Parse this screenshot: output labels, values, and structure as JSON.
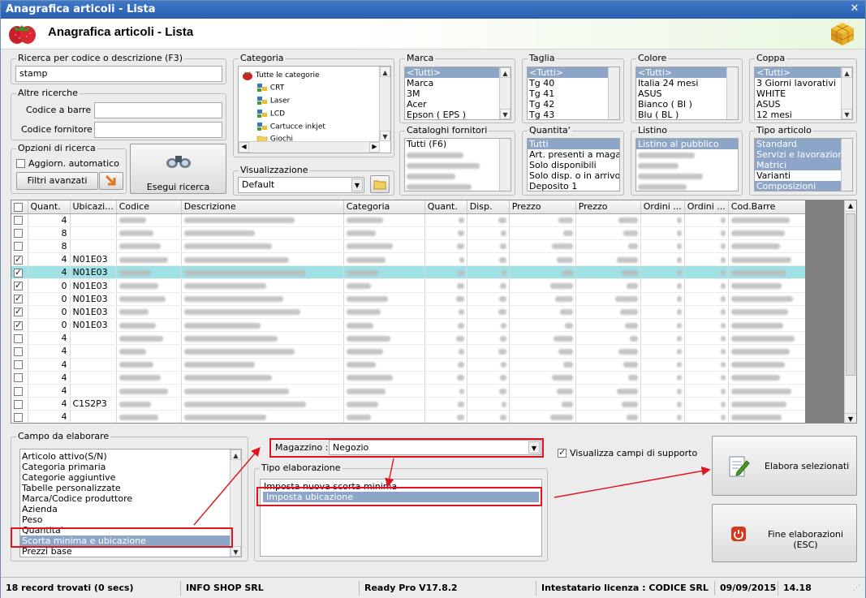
{
  "window": {
    "title": "Anagrafica articoli  - Lista",
    "close": "✕"
  },
  "header": {
    "title": "Anagrafica articoli  - Lista"
  },
  "search": {
    "legend": "Ricerca per codice o descrizione (F3)",
    "value": "stamp"
  },
  "altre": {
    "legend": "Altre ricerche",
    "barcode_label": "Codice a barre :",
    "supplier_label": "Codice fornitore :",
    "barcode_value": "",
    "supplier_value": ""
  },
  "opzioni": {
    "legend": "Opzioni di ricerca",
    "auto_update": "Aggiorn. automatico",
    "filters_button": "Filtri avanzati"
  },
  "esegui": {
    "label": "Esegui ricerca"
  },
  "categoria": {
    "legend": "Categoria",
    "root": "Tutte le categorie",
    "items": [
      "CRT",
      "Laser",
      "LCD",
      "Cartucce inkjet",
      "Giochi"
    ]
  },
  "visualizzazione": {
    "legend": "Visualizzazione",
    "value": "Default"
  },
  "marca": {
    "legend": "Marca",
    "items": [
      "<Tutti>",
      "Marca",
      "3M",
      "Acer",
      "Epson ( EPS )"
    ]
  },
  "taglia": {
    "legend": "Taglia",
    "items": [
      "<Tutti>",
      "Tg 40",
      "Tg 41",
      "Tg 42",
      "Tg 43"
    ]
  },
  "colore": {
    "legend": "Colore",
    "items": [
      "<Tutti>",
      "Italia 24 mesi",
      "ASUS",
      "Bianco ( BI )",
      "Blu ( BL )"
    ]
  },
  "coppa": {
    "legend": "Coppa",
    "items": [
      "<Tutti>",
      "3 Giorni lavorativi",
      "WHITE",
      "ASUS",
      "12 mesi"
    ]
  },
  "cataloghi": {
    "legend": "Cataloghi fornitori",
    "items": [
      "Tutti (F6)"
    ]
  },
  "quantita": {
    "legend": "Quantita'",
    "items": [
      "Tutti",
      "Art. presenti a magazzino",
      "Solo disponibili",
      "Solo disp. o in arrivo",
      "Deposito 1"
    ]
  },
  "listino": {
    "legend": "Listino",
    "items": [
      "Listino al pubblico"
    ]
  },
  "tipo_articolo": {
    "legend": "Tipo articolo",
    "items": [
      "Standard",
      "Servizi e lavorazioni",
      "Matrici",
      "Varianti",
      "Composizioni"
    ]
  },
  "grid": {
    "columns": [
      "",
      "Quant.",
      "Ubicazi...",
      "Codice",
      "Descrizione",
      "Categoria",
      "Quant.",
      "Disp.",
      "Prezzo",
      "Prezzo",
      "Ordini ...",
      "Ordini ...",
      "Cod.Barre"
    ],
    "rows": [
      {
        "checked": false,
        "quant": "4",
        "ubic": "",
        "hl": false
      },
      {
        "checked": false,
        "quant": "8",
        "ubic": "",
        "hl": false
      },
      {
        "checked": false,
        "quant": "8",
        "ubic": "",
        "hl": false
      },
      {
        "checked": true,
        "quant": "4",
        "ubic": "N01E03",
        "hl": false
      },
      {
        "checked": true,
        "quant": "4",
        "ubic": "N01E03",
        "hl": true
      },
      {
        "checked": true,
        "quant": "0",
        "ubic": "N01E03",
        "hl": false
      },
      {
        "checked": true,
        "quant": "0",
        "ubic": "N01E03",
        "hl": false
      },
      {
        "checked": true,
        "quant": "0",
        "ubic": "N01E03",
        "hl": false
      },
      {
        "checked": true,
        "quant": "0",
        "ubic": "N01E03",
        "hl": false
      },
      {
        "checked": false,
        "quant": "4",
        "ubic": "",
        "hl": false
      },
      {
        "checked": false,
        "quant": "4",
        "ubic": "",
        "hl": false
      },
      {
        "checked": false,
        "quant": "4",
        "ubic": "",
        "hl": false
      },
      {
        "checked": false,
        "quant": "4",
        "ubic": "",
        "hl": false
      },
      {
        "checked": false,
        "quant": "4",
        "ubic": "",
        "hl": false
      },
      {
        "checked": false,
        "quant": "4",
        "ubic": "C1S2P3",
        "hl": false
      },
      {
        "checked": false,
        "quant": "4",
        "ubic": "",
        "hl": false
      }
    ]
  },
  "campo": {
    "legend": "Campo da elaborare",
    "items": [
      "Articolo attivo(S/N)",
      "Categoria primaria",
      "Categorie aggiuntive",
      "Tabelle personalizzate",
      "Marca/Codice produttore",
      "Azienda",
      "Peso",
      "Quantita'",
      "Scorta minima e ubicazione",
      "Prezzi base"
    ],
    "selected_index": 8
  },
  "magazzino": {
    "label": "Magazzino :",
    "value": "Negozio"
  },
  "supporto": {
    "label": "Visualizza campi di supporto",
    "checked": true
  },
  "tipo_elab": {
    "legend": "Tipo elaborazione",
    "items": [
      "Imposta nuova scorta minima",
      "Imposta ubicazione"
    ],
    "selected_index": 1
  },
  "elabora": {
    "label": "Elabora selezionati"
  },
  "fine": {
    "label": "Fine elaborazioni (ESC)"
  },
  "status": {
    "records": "18 record trovati (0 secs)",
    "company": "INFO SHOP SRL",
    "version": "Ready Pro V17.8.2",
    "license": "Intestatario licenza : CODICE SRL",
    "date": "09/09/2015",
    "time": "14.18"
  },
  "colors": {
    "accent": "#e0141e",
    "selection": "#8da6c8",
    "highlight_row": "#9fe1e5"
  }
}
